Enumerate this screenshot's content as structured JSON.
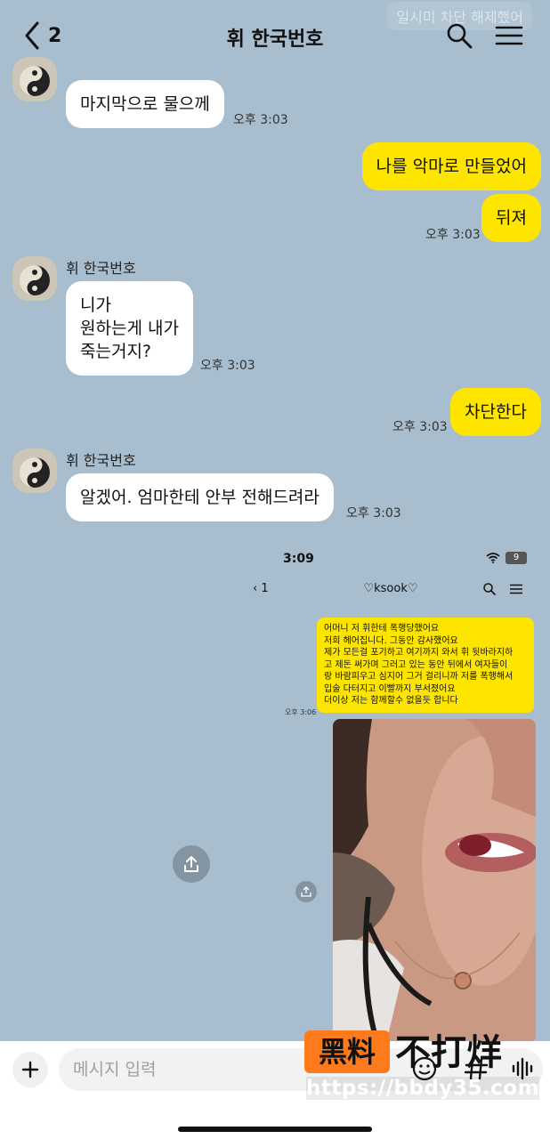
{
  "header": {
    "back_count": "2",
    "title": "휘 한국번호",
    "watermark": "일시미 차단 해제했어"
  },
  "chat": {
    "msg1_text": "마지막으로 물으께",
    "msg1_time": "오후 3:03",
    "msg2_text": "나를 악마로 만들었어",
    "msg3_text": "뒤져",
    "msg3_time": "오후 3:03",
    "msg4_sender": "휘 한국번호",
    "msg4_text": "니가\n원하는게 내가\n죽는거지?",
    "msg4_time": "오후 3:03",
    "msg5_text": "차단한다",
    "msg5_time": "오후 3:03",
    "msg6_sender": "휘 한국번호",
    "msg6_text": "알겠어. 엄마한테 안부 전해드려라",
    "msg6_time": "오후 3:03"
  },
  "embed": {
    "status_time": "3:09",
    "battery": "9",
    "back_count": "1",
    "title": "♡ksook♡",
    "bubble_text": "어머니 저 휘한테 폭행당했어요\n저희 헤어집니다. 그동안 감사했어요\n제가 모든걸 포기하고 여기까지 와서 휘 뒷바라지하\n고 제돈 써가며 그러고 있는 동안 뒤에서 여자들이\n랑 바람피우고 심지어 그거 걸리니까 저를 폭행해서\n입술 다터지고 이빨까지 부서졌어요\n더이상 저는 함께할수 없을듯 합니다",
    "time": "오후 3:06"
  },
  "input": {
    "placeholder": "메시지 입력"
  },
  "watermark": {
    "logo_box": "黑料",
    "logo_text": "不打烊",
    "url": "https://bbdy35.com"
  },
  "icons": [
    "back-chevron-icon",
    "search-icon",
    "menu-icon",
    "plus-icon",
    "emoji-icon",
    "hash-icon",
    "voice-icon",
    "share-icon",
    "wifi-icon"
  ],
  "colors": {
    "background": "#a8bdcd",
    "my_bubble": "#fee500",
    "their_bubble": "#ffffff",
    "logo_orange": "#ff7a1a"
  }
}
